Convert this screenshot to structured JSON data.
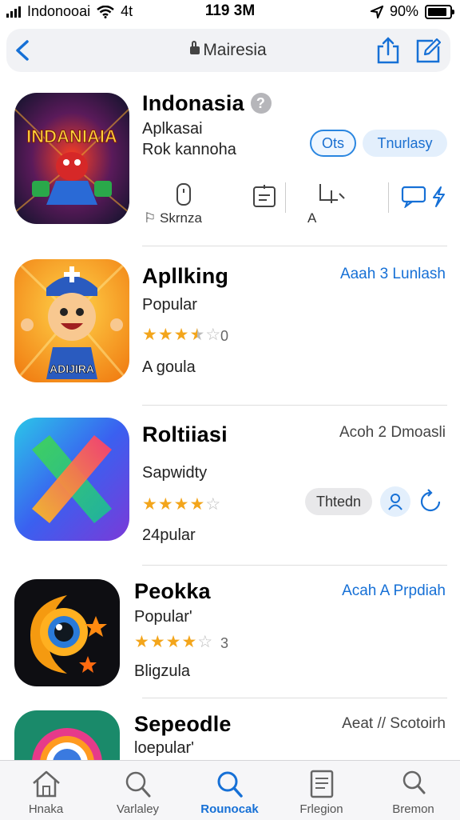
{
  "status_bar": {
    "carrier": "Indonooai",
    "network": "4t",
    "time": "119 3M",
    "battery": "90%"
  },
  "nav": {
    "title": "Mairesia"
  },
  "featured": {
    "name": "Indonasia",
    "sub1": "Aplkasai",
    "sub2": "Rok kannoha",
    "btn_outline": "Ots",
    "btn_fill": "Tnurlasy",
    "metric_label_1": "Skrnza",
    "metric_label_2": "A",
    "icon_text": "INDANIAIA"
  },
  "apps": [
    {
      "name": "Apllking",
      "sub": "Popular",
      "link": "Aaah 3 Lunlash",
      "rating_num": "0",
      "foot": "A goula",
      "stars": 3.5,
      "icon_text": "ADIJIRA"
    },
    {
      "name": "Roltiiasi",
      "sub": "Sapwidty",
      "link": "Acoh 2 Dmoasli",
      "foot": "24pular",
      "stars": 4,
      "btn": "Thtedn"
    },
    {
      "name": "Peokka",
      "sub": "Popular'",
      "link": "Acah A Prpdiah",
      "rating_num": "3",
      "foot": "Bligzula",
      "stars": 4
    },
    {
      "name": "Sepeodle",
      "sub": "loepular'",
      "link": "Aeat // Scotoirh"
    }
  ],
  "tabs": [
    {
      "label": "Hnaka",
      "icon": "home-icon"
    },
    {
      "label": "Varlaley",
      "icon": "search-icon"
    },
    {
      "label": "Rounocak",
      "icon": "search-icon",
      "active": true
    },
    {
      "label": "Frlegion",
      "icon": "document-icon"
    },
    {
      "label": "Bremon",
      "icon": "person-icon"
    }
  ],
  "colors": {
    "accent": "#1670d6",
    "star": "#f3a51b"
  }
}
